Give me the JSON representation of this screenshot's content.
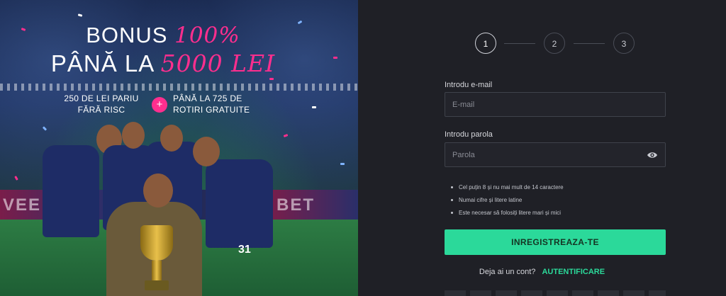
{
  "promo": {
    "bonus_prefix": "BONUS",
    "bonus_percent": "100%",
    "bonus_upto": "PÂNĂ LA",
    "bonus_amount": "5000 LEI",
    "offer_left": "250 DE LEI PARIU FĂRĂ RISC",
    "offer_plus": "+",
    "offer_right": "PÂNĂ LA 725 DE ROTIRI GRATUITE",
    "jersey_number": "31",
    "accent_color": "#ff2e8e"
  },
  "steps": [
    "1",
    "2",
    "3"
  ],
  "form": {
    "email_label": "Introdu e-mail",
    "email_placeholder": "E-mail",
    "email_value": "",
    "password_label": "Introdu parola",
    "password_placeholder": "Parola",
    "password_value": "",
    "password_rules": [
      "Cel puțin 8 și nu mai mult de 14 caractere",
      "Numai cifre și litere latine",
      "Este necesar să folosiți litere mari și mici"
    ],
    "register_label": "INREGISTREAZA-TE",
    "login_question": "Deja ai un cont?",
    "login_link": "AUTENTIFICARE",
    "primary_color": "#2bd99a"
  }
}
